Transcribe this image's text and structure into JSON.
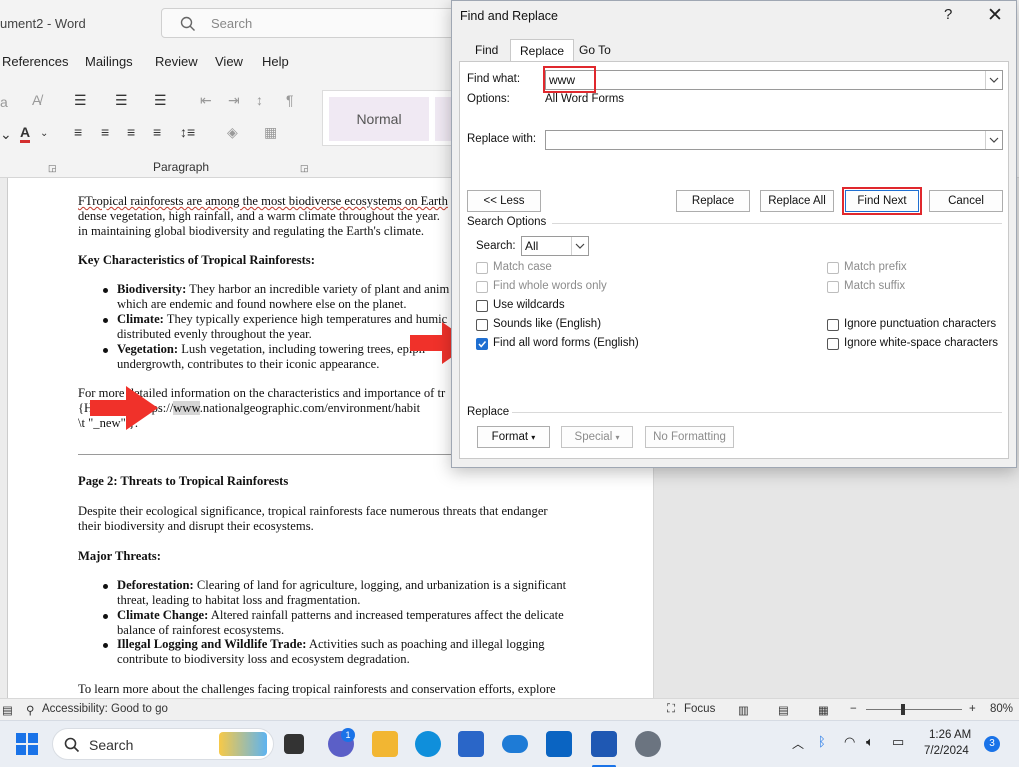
{
  "app": {
    "title": "ument2 - Word",
    "search_placeholder": "Search"
  },
  "ribbon": {
    "tabs": [
      "References",
      "Mailings",
      "Review",
      "View",
      "Help"
    ],
    "group_label": "Paragraph",
    "style_name": "Normal"
  },
  "document": {
    "p1": [
      "FTropical rainforests are among the most biodiverse ecosystems on Earth",
      "dense vegetation, high rainfall, and a warm climate throughout the year.",
      "in maintaining global biodiversity and regulating the Earth's climate."
    ],
    "h1": "Key Characteristics of Tropical Rainforests:",
    "bullets1": [
      {
        "bold": "Biodiversity:",
        "text": " They harbor an incredible variety of plant and anim",
        "cont": "which are endemic and found nowhere else on the planet."
      },
      {
        "bold": "Climate:",
        "text": " They typically experience high temperatures and humic",
        "cont": "distributed evenly throughout the year."
      },
      {
        "bold": "Vegetation:",
        "text": " Lush vegetation, including towering trees, epiph",
        "cont": "undergrowth, contributes to their iconic appearance."
      }
    ],
    "p2": [
      "For more detailed information on the characteristics and importance of tr",
      "{H",
      "\"https://",
      "www",
      ".nationalgeographic.com/environment/habit",
      "\\t \"_new\" }."
    ],
    "h2": "Page 2: Threats to Tropical Rainforests",
    "p3": [
      "Despite their ecological significance, tropical rainforests face numerous threats that endanger",
      "their biodiversity and disrupt their ecosystems."
    ],
    "h3": "Major Threats:",
    "bullets2": [
      {
        "bold": "Deforestation:",
        "text": " Clearing of land for agriculture, logging, and urbanization is a significant",
        "cont": "threat, leading to habitat loss and fragmentation."
      },
      {
        "bold": "Climate Change:",
        "text": " Altered rainfall patterns and increased temperatures affect the delicate",
        "cont": "balance of rainforest ecosystems."
      },
      {
        "bold": "Illegal Logging and Wildlife Trade:",
        "text": " Activities such as poaching and illegal logging",
        "cont": "contribute to biodiversity loss and ecosystem degradation."
      }
    ],
    "p4": "To learn more about the challenges facing tropical rainforests and conservation efforts, explore"
  },
  "statusbar": {
    "accessibility": "Accessibility: Good to go",
    "focus": "Focus",
    "zoom": "80%"
  },
  "taskbar": {
    "search": "Search",
    "chat_badge": "1",
    "time": "1:26 AM",
    "date": "7/2/2024",
    "notif_badge": "3"
  },
  "dialog": {
    "title": "Find and Replace",
    "tabs": [
      "Find",
      "Replace",
      "Go To"
    ],
    "find_label": "Find what:",
    "find_value": "www",
    "options_label": "Options:",
    "options_value": "All Word Forms",
    "replace_label": "Replace with:",
    "replace_value": "",
    "less_btn": "<< Less",
    "replace_btn": "Replace",
    "replace_all_btn": "Replace All",
    "find_next_btn": "Find Next",
    "cancel_btn": "Cancel",
    "search_options_label": "Search Options",
    "search_label": "Search:",
    "search_value": "All",
    "checkboxes_left": [
      {
        "label": "Match case",
        "checked": false,
        "disabled": true
      },
      {
        "label": "Find whole words only",
        "checked": false,
        "disabled": true
      },
      {
        "label": "Use wildcards",
        "checked": false,
        "disabled": false
      },
      {
        "label": "Sounds like (English)",
        "checked": false,
        "disabled": false
      },
      {
        "label": "Find all word forms (English)",
        "checked": true,
        "disabled": false
      }
    ],
    "checkboxes_right": [
      {
        "label": "Match prefix",
        "checked": false,
        "disabled": true
      },
      {
        "label": "Match suffix",
        "checked": false,
        "disabled": true
      },
      {
        "label": "Ignore punctuation characters",
        "checked": false,
        "disabled": false
      },
      {
        "label": "Ignore white-space characters",
        "checked": false,
        "disabled": false
      }
    ],
    "replace_section_label": "Replace",
    "format_btn": "Format",
    "special_btn": "Special",
    "no_formatting_btn": "No Formatting"
  },
  "colors": {
    "highlight_red": "#e0282d",
    "checkbox_blue": "#1f6fd1",
    "arrow_red": "#f0312a"
  }
}
